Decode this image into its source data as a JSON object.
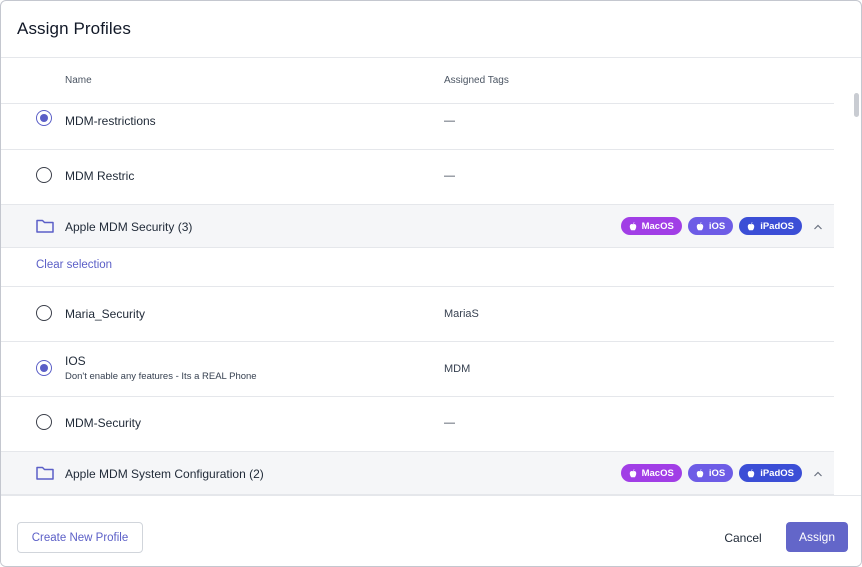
{
  "dialog": {
    "title": "Assign Profiles"
  },
  "columns": {
    "name": "Name",
    "assigned_tags": "Assigned Tags"
  },
  "profiles_top": [
    {
      "name": "MDM-restrictions",
      "tags": "—",
      "selected": true
    },
    {
      "name": "MDM Restric",
      "tags": "—",
      "selected": false
    }
  ],
  "group1": {
    "name": "Apple MDM Security (3)",
    "badges": [
      {
        "label": "MacOS",
        "color": "#a13ee6"
      },
      {
        "label": "iOS",
        "color": "#6d5ce6"
      },
      {
        "label": "iPadOS",
        "color": "#3b4ed6"
      }
    ],
    "clear_selection": "Clear selection",
    "items": [
      {
        "name": "Maria_Security",
        "description": "",
        "tags": "MariaS",
        "selected": false
      },
      {
        "name": "IOS",
        "description": "Don't enable any features - Its a REAL Phone",
        "tags": "MDM",
        "selected": true
      },
      {
        "name": "MDM-Security",
        "description": "",
        "tags": "—",
        "selected": false
      }
    ]
  },
  "group2": {
    "name": "Apple MDM System Configuration (2)",
    "badges": [
      {
        "label": "MacOS",
        "color": "#a13ee6"
      },
      {
        "label": "iOS",
        "color": "#6d5ce6"
      },
      {
        "label": "iPadOS",
        "color": "#3b4ed6"
      }
    ]
  },
  "footer": {
    "create_label": "Create New Profile",
    "cancel_label": "Cancel",
    "assign_label": "Assign"
  },
  "colors": {
    "accent": "#5b5fc7",
    "primary_button": "#6366c9"
  }
}
